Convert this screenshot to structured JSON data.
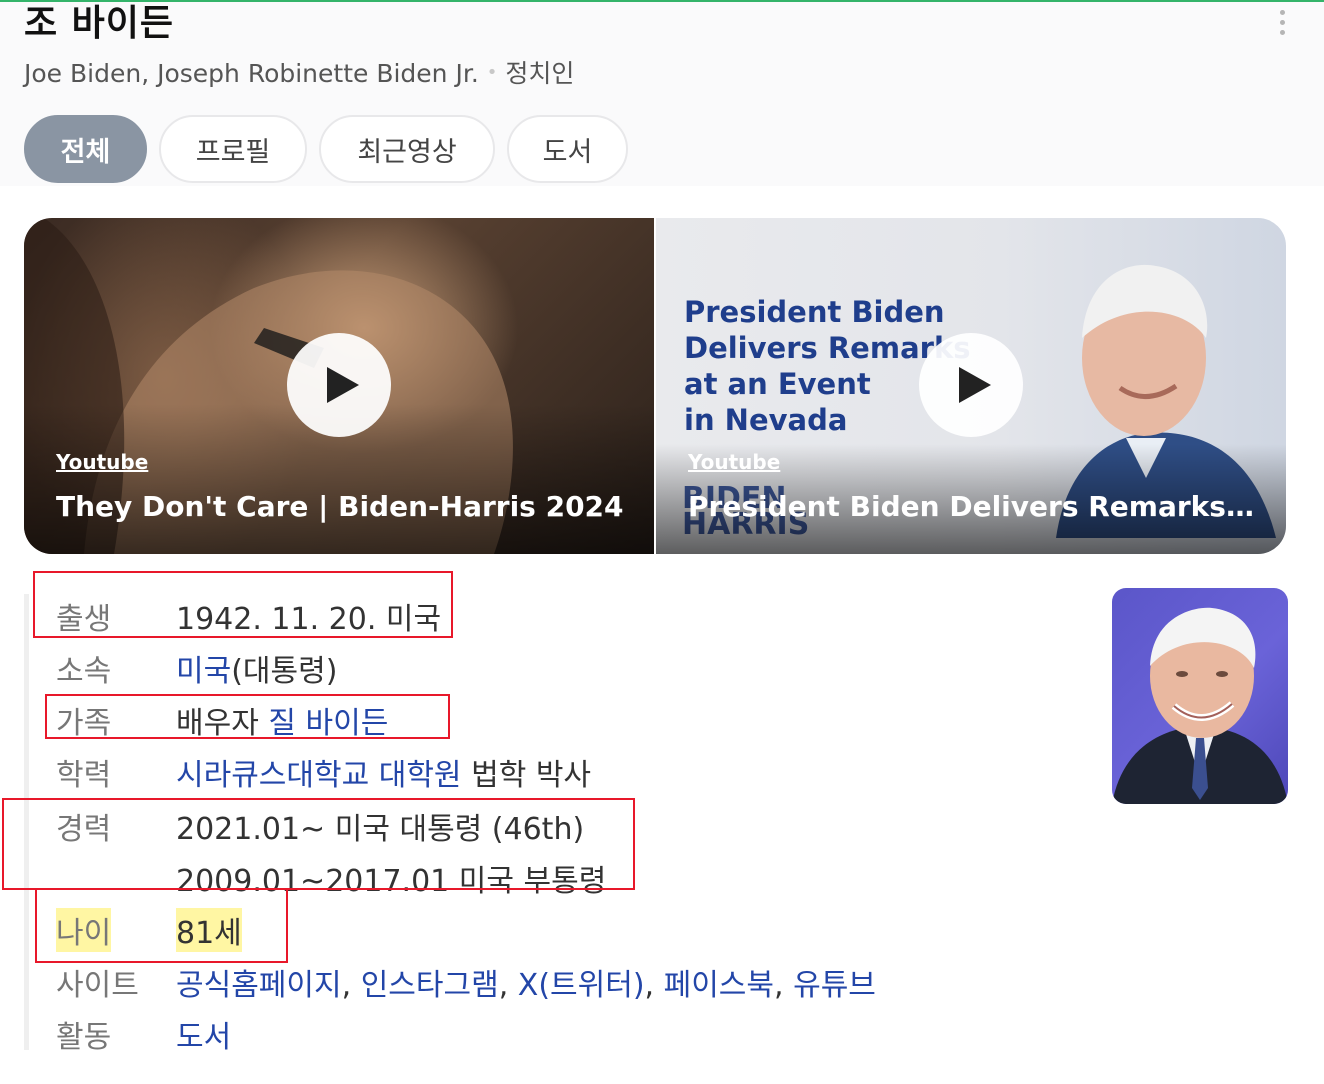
{
  "header": {
    "title": "조 바이든",
    "alt_names": "Joe Biden, Joseph Robinette Biden Jr.",
    "category": "정치인"
  },
  "tabs": [
    {
      "label": "전체",
      "active": true
    },
    {
      "label": "프로필",
      "active": false
    },
    {
      "label": "최근영상",
      "active": false
    },
    {
      "label": "도서",
      "active": false
    }
  ],
  "videos": [
    {
      "source": "Youtube",
      "title": "They Don't Care | Biden-Harris 2024"
    },
    {
      "source": "Youtube",
      "title": "President Biden Delivers Remarks at an...",
      "thumbnail_text": "President Biden\nDelivers Remarks\nat an Event\nin Nevada",
      "thumbnail_logo": "BIDEN\nHARRIS"
    }
  ],
  "profile": {
    "birth": {
      "label": "출생",
      "value": "1942. 11. 20. 미국"
    },
    "affiliation": {
      "label": "소속",
      "link": "미국",
      "suffix": "(대통령)"
    },
    "family": {
      "label": "가족",
      "prefix": "배우자",
      "link": "질 바이든"
    },
    "education": {
      "label": "학력",
      "link": "시라큐스대학교 대학원",
      "suffix": "법학 박사"
    },
    "career": {
      "label": "경력",
      "items": [
        "2021.01~ 미국 대통령 (46th)",
        "2009.01~2017.01 미국 부통령"
      ]
    },
    "age": {
      "label": "나이",
      "value": "81세"
    },
    "sites": {
      "label": "사이트",
      "links": [
        "공식홈페이지",
        "인스타그램",
        "X(트위터)",
        "페이스북",
        "유튜브"
      ],
      "separator": ", "
    },
    "activity": {
      "label": "활동",
      "link": "도서"
    }
  },
  "colors": {
    "link": "#2346a8",
    "tab_active_bg": "#8a95a3",
    "highlight": "#fff6a3",
    "annotation_box": "#e8182a",
    "portrait_bg": "#5b56c9"
  }
}
